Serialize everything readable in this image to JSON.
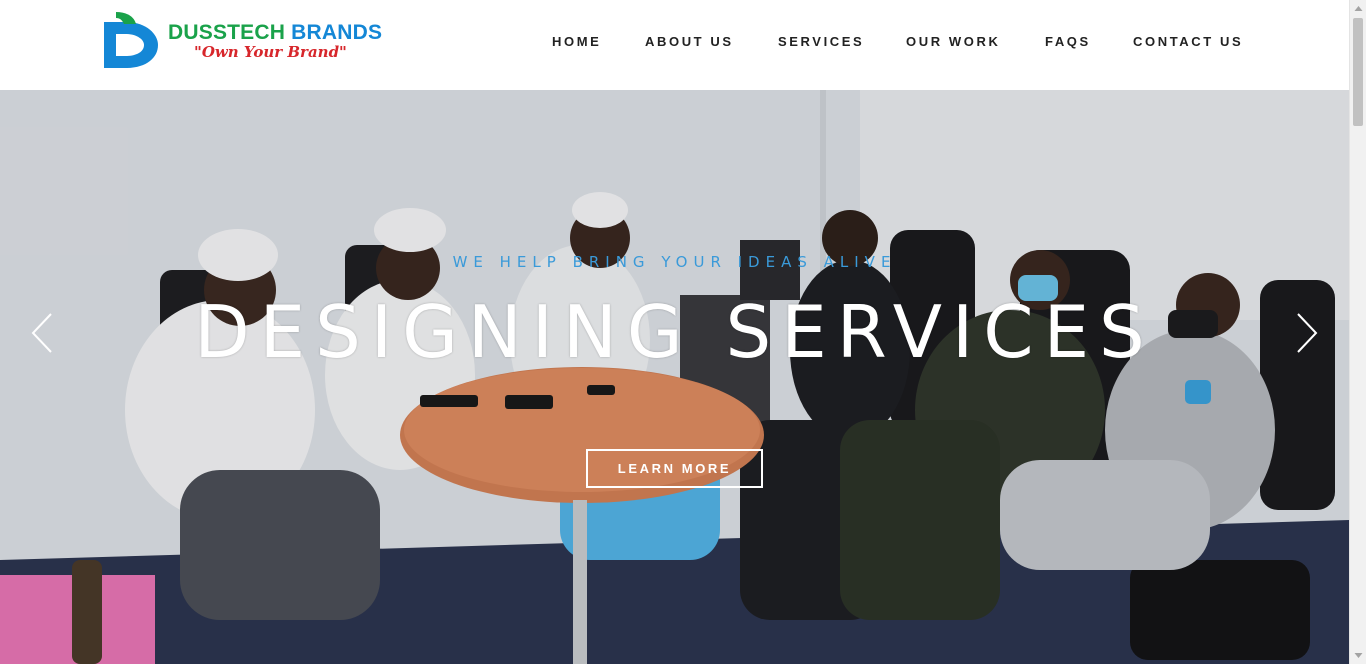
{
  "brand": {
    "name_part1": "DUSSTECH",
    "name_part2": "BRANDS",
    "tagline": "\"Own Your Brand\"",
    "colors": {
      "green": "#1aa24a",
      "blue": "#1487d6",
      "red": "#d7262b"
    }
  },
  "nav": {
    "items": [
      {
        "label": "HOME"
      },
      {
        "label": "ABOUT US"
      },
      {
        "label": "SERVICES"
      },
      {
        "label": "OUR WORK"
      },
      {
        "label": "FAQS"
      },
      {
        "label": "CONTACT US"
      }
    ]
  },
  "hero": {
    "subtitle": "WE HELP BRING YOUR IDEAS ALIVE",
    "title": "DESIGNING SERVICES",
    "button_label": "LEARN MORE",
    "prev_icon": "chevron-left-icon",
    "next_icon": "chevron-right-icon",
    "accent_color": "#3a9ad9"
  }
}
